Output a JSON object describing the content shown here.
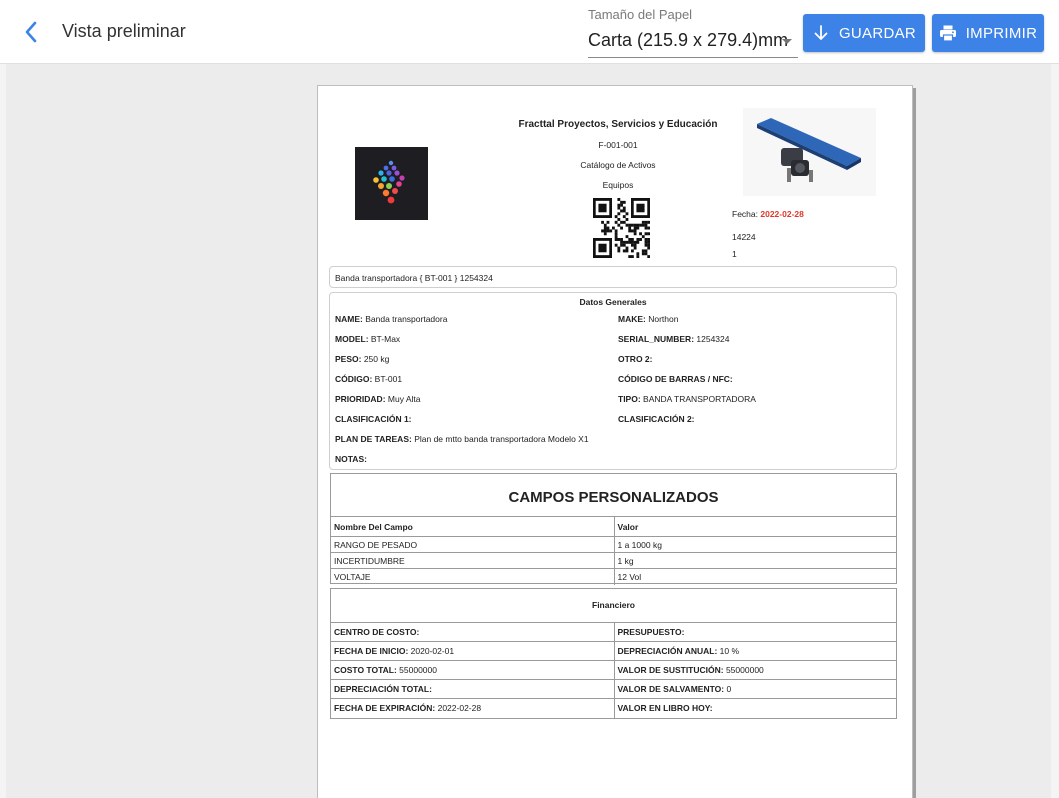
{
  "topbar": {
    "title": "Vista preliminar",
    "paper_size_label": "Tamaño del Papel",
    "paper_size_value": "Carta (215.9 x 279.4)mm",
    "save_label": "GUARDAR",
    "print_label": "IMPRIMIR"
  },
  "colors": {
    "accent": "#3d82e6",
    "date": "#e0352b",
    "background": "#ececec"
  },
  "header": {
    "company": "Fracttal Proyectos, Servicios y Educación",
    "code": "F-001-001",
    "catalog": "Catálogo de Activos",
    "category": "Equipos",
    "date_label": "Fecha:",
    "date_value": "2022-02-28",
    "number1": "14224",
    "number2": "1"
  },
  "asset_title": "Banda transportadora { BT-001 } 1254324",
  "general": {
    "title": "Datos Generales",
    "fields": [
      {
        "label": "NAME:",
        "value": " Banda transportadora"
      },
      {
        "label": "MAKE:",
        "value": " Northon"
      },
      {
        "label": "MODEL:",
        "value": " BT-Max"
      },
      {
        "label": "SERIAL_NUMBER:",
        "value": " 1254324"
      },
      {
        "label": "PESO:",
        "value": " 250 kg"
      },
      {
        "label": "OTRO 2:",
        "value": ""
      },
      {
        "label": "CÓDIGO:",
        "value": " BT-001"
      },
      {
        "label": "CÓDIGO DE BARRAS / NFC:",
        "value": ""
      },
      {
        "label": "PRIORIDAD:",
        "value": " Muy Alta"
      },
      {
        "label": "TIPO:",
        "value": " BANDA TRANSPORTADORA"
      },
      {
        "label": "CLASIFICACIÓN 1:",
        "value": ""
      },
      {
        "label": "CLASIFICACIÓN 2:",
        "value": ""
      },
      {
        "label": "PLAN DE TAREAS:",
        "value": " Plan de mtto banda transportadora Modelo X1"
      },
      {
        "label": "NOTAS:",
        "value": ""
      }
    ]
  },
  "custom": {
    "title": "CAMPOS PERSONALIZADOS",
    "col_name": "Nombre Del Campo",
    "col_value": "Valor",
    "rows": [
      {
        "name": "RANGO DE PESADO",
        "value": "1 a 1000 kg"
      },
      {
        "name": "INCERTIDUMBRE",
        "value": "1 kg"
      },
      {
        "name": "VOLTAJE",
        "value": "12 Vol"
      }
    ]
  },
  "financial": {
    "title": "Financiero",
    "rows": [
      [
        {
          "label": "CENTRO DE COSTO:",
          "value": ""
        },
        {
          "label": "PRESUPUESTO:",
          "value": ""
        }
      ],
      [
        {
          "label": "FECHA DE INICIO:",
          "value": " 2020-02-01"
        },
        {
          "label": "DEPRECIACIÓN ANUAL:",
          "value": " 10 %"
        }
      ],
      [
        {
          "label": "COSTO TOTAL:",
          "value": " 55000000"
        },
        {
          "label": "VALOR DE SUSTITUCIÓN:",
          "value": " 55000000"
        }
      ],
      [
        {
          "label": "DEPRECIACIÓN TOTAL:",
          "value": ""
        },
        {
          "label": "VALOR DE SALVAMENTO:",
          "value": " 0"
        }
      ],
      [
        {
          "label": "FECHA DE EXPIRACIÓN:",
          "value": " 2022-02-28"
        },
        {
          "label": "VALOR EN LIBRO HOY:",
          "value": ""
        }
      ]
    ]
  }
}
